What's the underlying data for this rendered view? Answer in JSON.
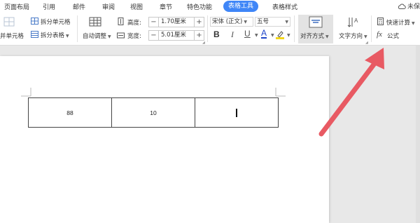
{
  "menubar": {
    "items": [
      "页面布局",
      "引用",
      "邮件",
      "审阅",
      "视图",
      "章节",
      "特色功能",
      "表格工具",
      "表格样式"
    ],
    "active": "表格工具",
    "save_label": "未保"
  },
  "ribbon": {
    "merge_cells": "并单元格",
    "split_cells": "拆分单元格",
    "split_table": "拆分表格",
    "auto_fit": "自动调整",
    "height_label": "高度:",
    "height_value": "1.70厘米",
    "width_label": "宽度:",
    "width_value": "5.01厘米",
    "font_name": "宋体 (正文)",
    "font_size": "五号",
    "bold": "B",
    "italic": "I",
    "underline": "U",
    "font_color": "A",
    "align": "对齐方式",
    "text_direction": "文字方向",
    "quick_calc": "快速计算",
    "formula": "公式",
    "formula_icon": "fx",
    "minus": "−",
    "plus": "+"
  },
  "table": {
    "cells": [
      "88",
      "10",
      ""
    ]
  },
  "colors": {
    "accent": "#3f86f7",
    "arrow": "#e85a63"
  }
}
